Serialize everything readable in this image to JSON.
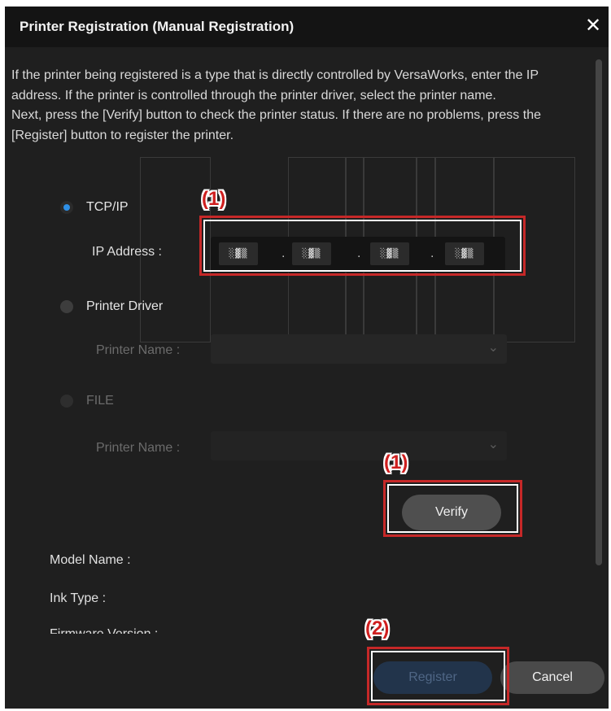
{
  "dialog": {
    "title": "Printer Registration (Manual Registration)",
    "close_icon": "✕",
    "instructions": [
      "If the printer being registered is a type that is directly controlled by VersaWorks, enter the IP address. If the printer is controlled through the printer driver, select the printer name.",
      "Next, press the [Verify] button to check the printer status. If there are no problems, press the [Register] button to register the printer."
    ]
  },
  "options": {
    "tcpip": {
      "label": "TCP/IP",
      "selected": true
    },
    "ip_address": {
      "label": "IP Address :",
      "segments": [
        "░▓▒",
        "░▓▒",
        "░▓▒",
        "░▓▒"
      ],
      "separator": "."
    },
    "printer_driver": {
      "label": "Printer Driver",
      "selected": false,
      "printer_name_label": "Printer Name :",
      "chevron": "⌄"
    },
    "file": {
      "label": "FILE",
      "selected": false,
      "printer_name_label": "Printer Name :",
      "chevron": "⌄"
    }
  },
  "buttons": {
    "verify": "Verify",
    "register": "Register",
    "cancel": "Cancel"
  },
  "info": {
    "model_name": "Model Name :",
    "ink_type": "Ink Type :",
    "firmware_version": "Firmware Version :"
  },
  "callouts": {
    "ip_marker": "(1)",
    "verify_marker": "(1)",
    "register_marker": "(2)"
  },
  "colors": {
    "dialog_bg": "#1f1f1f",
    "titlebar_bg": "#141414",
    "accent_blue": "#2e8fe6",
    "callout_red": "#c62828"
  }
}
